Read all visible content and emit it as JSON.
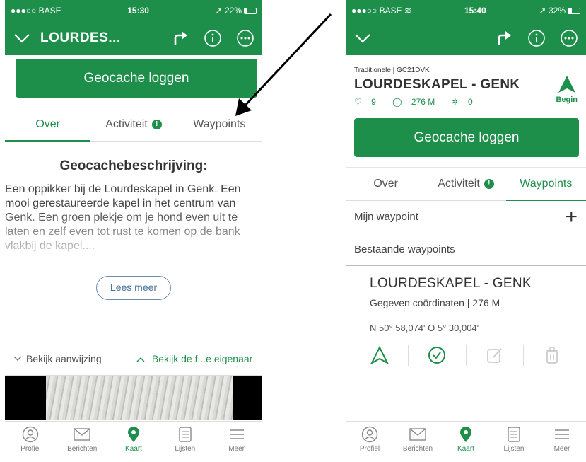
{
  "left": {
    "status": {
      "carrier": "●●●○○ BASE",
      "time": "15:30",
      "battery": "22%",
      "battery_level": 0.22
    },
    "nav": {
      "title": "LOURDES..."
    },
    "log_button": "Geocache loggen",
    "tabs": [
      {
        "label": "Over",
        "active": true
      },
      {
        "label": "Activiteit",
        "badge": "!"
      },
      {
        "label": "Waypoints"
      }
    ],
    "description": {
      "title": "Geocachebeschrijving:",
      "text": "Een oppikker bij de Lourdeskapel in Genk. Een mooi gerestaureerde kapel in het centrum van Genk. Een groen plekje om je hond even uit te laten en zelf even tot rust te komen op de bank vlakbij de kapel....",
      "more": "Lees meer"
    },
    "hint_row": {
      "hint": "Bekijk aanwijzing",
      "owner": "Bekijk de f...e eigenaar"
    }
  },
  "right": {
    "status": {
      "carrier": "●●●○○ BASE",
      "time": "15:40",
      "battery": "32%",
      "battery_level": 0.32
    },
    "cache": {
      "type": "Traditionele | GC21DVK",
      "name": "LOURDESKAPEL - GENK",
      "favorites": "9",
      "distance": "276 M",
      "trackables": "0",
      "begin": "Begin"
    },
    "log_button": "Geocache loggen",
    "tabs": [
      {
        "label": "Over"
      },
      {
        "label": "Activiteit",
        "badge": "!"
      },
      {
        "label": "Waypoints",
        "active": true
      }
    ],
    "my_waypoint": "Mijn waypoint",
    "existing_waypoints": "Bestaande waypoints",
    "waypoint": {
      "name": "LOURDESKAPEL - GENK",
      "sub": "Gegeven coördinaten | 276 M",
      "coords": "N 50° 58,074'   O 5° 30,004'"
    }
  },
  "tabbar": [
    {
      "label": "Profiel",
      "icon": "profile-icon"
    },
    {
      "label": "Berichten",
      "icon": "mail-icon"
    },
    {
      "label": "Kaart",
      "icon": "map-pin-icon",
      "active": true
    },
    {
      "label": "Lijsten",
      "icon": "list-icon"
    },
    {
      "label": "Meer",
      "icon": "menu-icon"
    }
  ],
  "colors": {
    "brand_green": "#1e8f4a",
    "link_blue": "#4a72a0"
  }
}
